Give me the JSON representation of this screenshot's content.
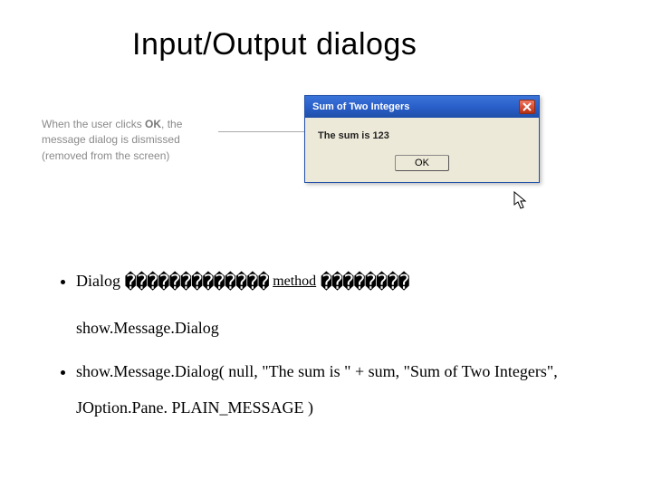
{
  "title": "Input/Output dialogs",
  "callout": {
    "line1_pre": "When the user clicks ",
    "ok": "OK",
    "line1_post": ", the",
    "line2": "message dialog is dismissed",
    "line3": "(removed from the screen)"
  },
  "dialog": {
    "window_title": "Sum of Two Integers",
    "message": "The sum is 123",
    "ok_label": "OK"
  },
  "bullets": {
    "b1": {
      "prefix": "Dialog ",
      "boxes1": "�������������",
      "method_word": "method",
      "boxes2": "��������",
      "hang": "show.Message.Dialog"
    },
    "b2": {
      "text": "show.Message.Dialog( null, \"The sum is \" + sum, \"Sum of Two Integers\", JOption.Pane. PLAIN_MESSAGE )"
    }
  }
}
